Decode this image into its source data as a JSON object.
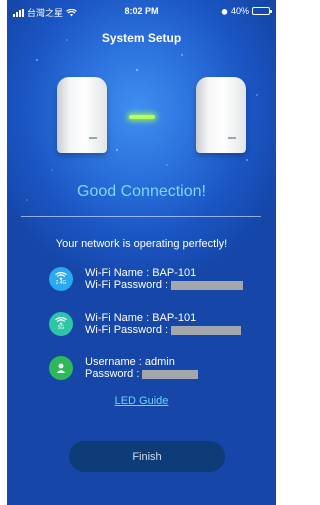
{
  "status_bar": {
    "carrier": "台灣之星",
    "time": "8:02 PM",
    "battery": "40%",
    "battery_level": 0.4
  },
  "header": {
    "title": "System Setup"
  },
  "connection": {
    "status": "Good Connection!",
    "summary": "Your network is operating perfectly!"
  },
  "networks": [
    {
      "band": "2.4G",
      "name_line": "Wi-Fi Name : BAP-101",
      "password_label": "Wi-Fi Password :",
      "icon": "wifi-icon",
      "color": "#29a9ee"
    },
    {
      "band": "5G",
      "name_line": "Wi-Fi Name : BAP-101",
      "password_label": "Wi-Fi Password :",
      "icon": "wifi-icon",
      "color": "#2ec4a6"
    }
  ],
  "account": {
    "username_line": "Username : admin",
    "password_label": "Password :",
    "icon": "user-icon",
    "color": "#2eb85a"
  },
  "links": {
    "led_guide": "LED Guide"
  },
  "actions": {
    "finish": "Finish"
  },
  "colors": {
    "background": "#1b56c4",
    "accent_text": "#7fd7ff",
    "link_line": "#b8ff5a",
    "button": "#0d3c78"
  }
}
